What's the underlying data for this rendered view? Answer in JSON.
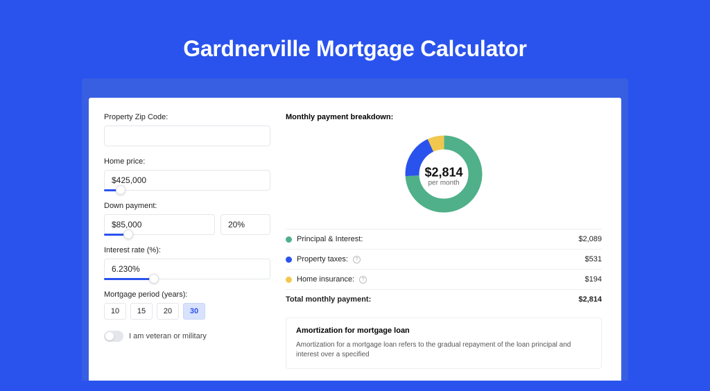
{
  "title": "Gardnerville Mortgage Calculator",
  "form": {
    "zip": {
      "label": "Property Zip Code:",
      "value": ""
    },
    "price": {
      "label": "Home price:",
      "value": "$425,000",
      "slider_pct": 10
    },
    "down": {
      "label": "Down payment:",
      "value": "$85,000",
      "pct": "20%",
      "slider_pct": 22
    },
    "rate": {
      "label": "Interest rate (%):",
      "value": "6.230%",
      "slider_pct": 30
    },
    "period": {
      "label": "Mortgage period (years):",
      "options": [
        "10",
        "15",
        "20",
        "30"
      ],
      "selected": "30"
    },
    "veteran": {
      "label": "I am veteran or military",
      "checked": false
    }
  },
  "breakdown": {
    "title": "Monthly payment breakdown:",
    "total": {
      "amount": "$2,814",
      "sub": "per month"
    },
    "items": [
      {
        "label": "Principal & Interest:",
        "value": "$2,089",
        "color": "#4fb089",
        "info": false,
        "pct": 74
      },
      {
        "label": "Property taxes:",
        "value": "$531",
        "color": "#2a53ed",
        "info": true,
        "pct": 19
      },
      {
        "label": "Home insurance:",
        "value": "$194",
        "color": "#f1c84d",
        "info": true,
        "pct": 7
      }
    ],
    "total_row": {
      "label": "Total monthly payment:",
      "value": "$2,814"
    }
  },
  "amortization": {
    "title": "Amortization for mortgage loan",
    "text": "Amortization for a mortgage loan refers to the gradual repayment of the loan principal and interest over a specified"
  },
  "chart_data": {
    "type": "pie",
    "title": "Monthly payment breakdown",
    "series": [
      {
        "name": "Principal & Interest",
        "value": 2089,
        "color": "#4fb089"
      },
      {
        "name": "Property taxes",
        "value": 531,
        "color": "#2a53ed"
      },
      {
        "name": "Home insurance",
        "value": 194,
        "color": "#f1c84d"
      }
    ],
    "total": 2814,
    "unit": "$ per month"
  }
}
